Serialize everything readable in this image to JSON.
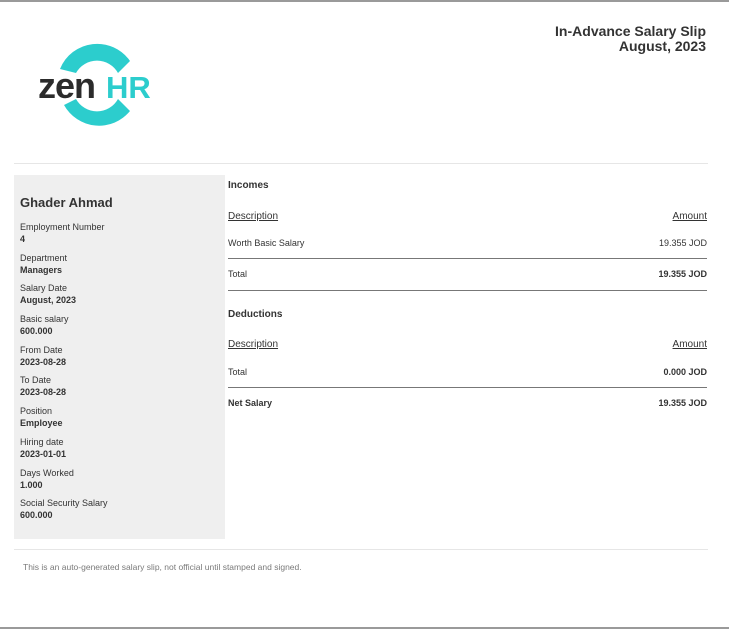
{
  "document": {
    "title": "In-Advance Salary Slip",
    "period": "August, 2023",
    "logo_text": "zenHR"
  },
  "employee": {
    "name": "Ghader Ahmad",
    "fields": [
      {
        "label": "Employment Number",
        "value": "4"
      },
      {
        "label": "Department",
        "value": "Managers"
      },
      {
        "label": "Salary Date",
        "value": "August, 2023"
      },
      {
        "label": "Basic salary",
        "value": "600.000"
      },
      {
        "label": "From Date",
        "value": "2023-08-28"
      },
      {
        "label": "To Date",
        "value": "2023-08-28"
      },
      {
        "label": "Position",
        "value": "Employee"
      },
      {
        "label": "Hiring date",
        "value": "2023-01-01"
      },
      {
        "label": "Days Worked",
        "value": "1.000"
      },
      {
        "label": "Social Security Salary",
        "value": "600.000"
      }
    ]
  },
  "incomes": {
    "title": "Incomes",
    "col_description": "Description",
    "col_amount": "Amount",
    "rows": [
      {
        "description": "Worth Basic Salary",
        "amount": "19.355 JOD"
      }
    ],
    "total_label": "Total",
    "total_amount": "19.355 JOD"
  },
  "deductions": {
    "title": "Deductions",
    "col_description": "Description",
    "col_amount": "Amount",
    "total_label": "Total",
    "total_amount": "0.000 JOD"
  },
  "net": {
    "label": "Net Salary",
    "amount": "19.355 JOD"
  },
  "footer": {
    "note": "This is an auto-generated salary slip, not official until stamped and signed."
  }
}
